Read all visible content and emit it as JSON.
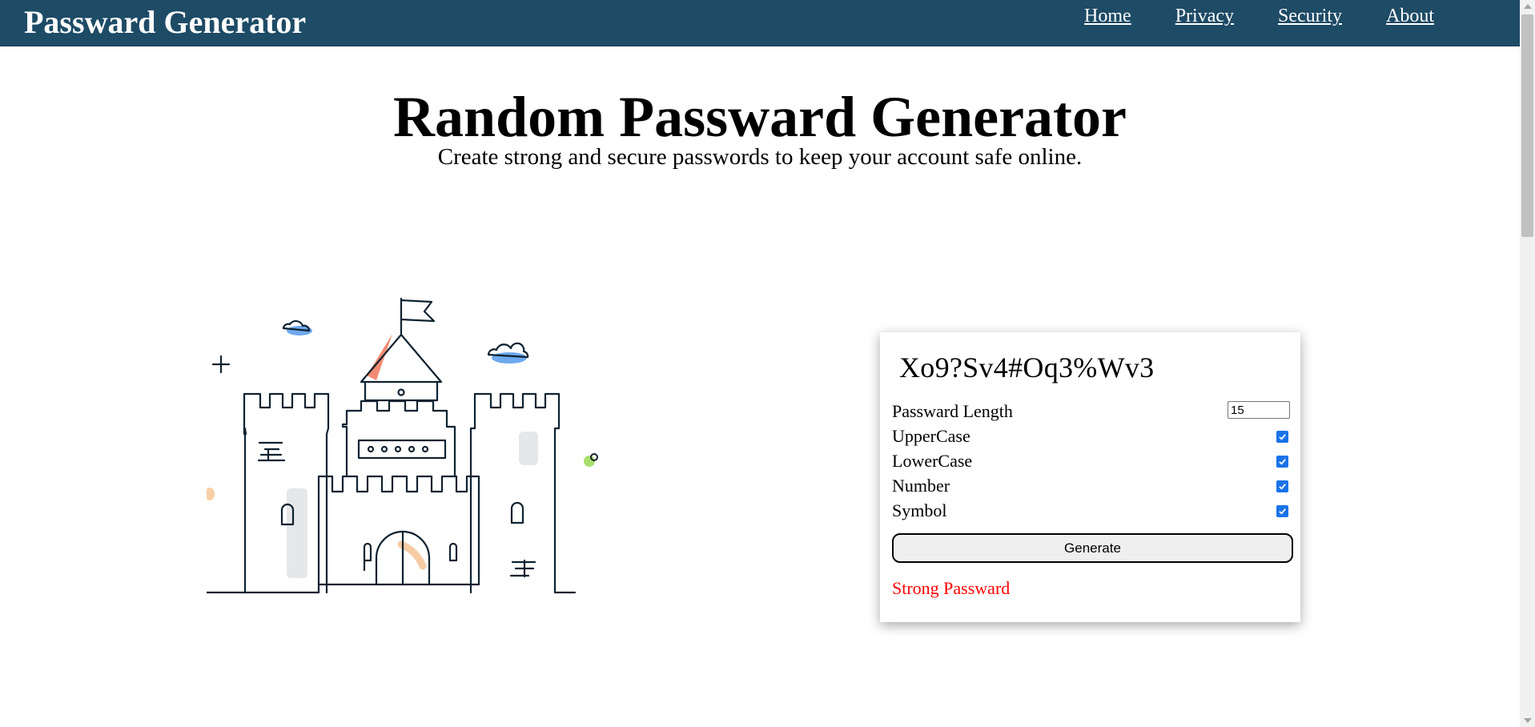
{
  "navbar": {
    "brand": "Passward Generator",
    "links": [
      "Home",
      "Privacy",
      "Security",
      "About"
    ],
    "background": "#1e4b66"
  },
  "hero": {
    "title": "Random Passward Generator",
    "subtitle": "Create strong and secure passwords to keep your account safe online."
  },
  "illustration": {
    "icon": "castle-illustration-icon"
  },
  "generator": {
    "password": "Xo9?Sv4#Oq3%Wv3",
    "length_label": "Passward Length",
    "length_value": "15",
    "options": [
      {
        "label": "UpperCase",
        "checked": true
      },
      {
        "label": "LowerCase",
        "checked": true
      },
      {
        "label": "Number",
        "checked": true
      },
      {
        "label": "Symbol",
        "checked": true
      }
    ],
    "button_label": "Generate",
    "strength": "Strong Passward",
    "strength_color": "#ff0000",
    "checkbox_color": "#1a73e8"
  }
}
